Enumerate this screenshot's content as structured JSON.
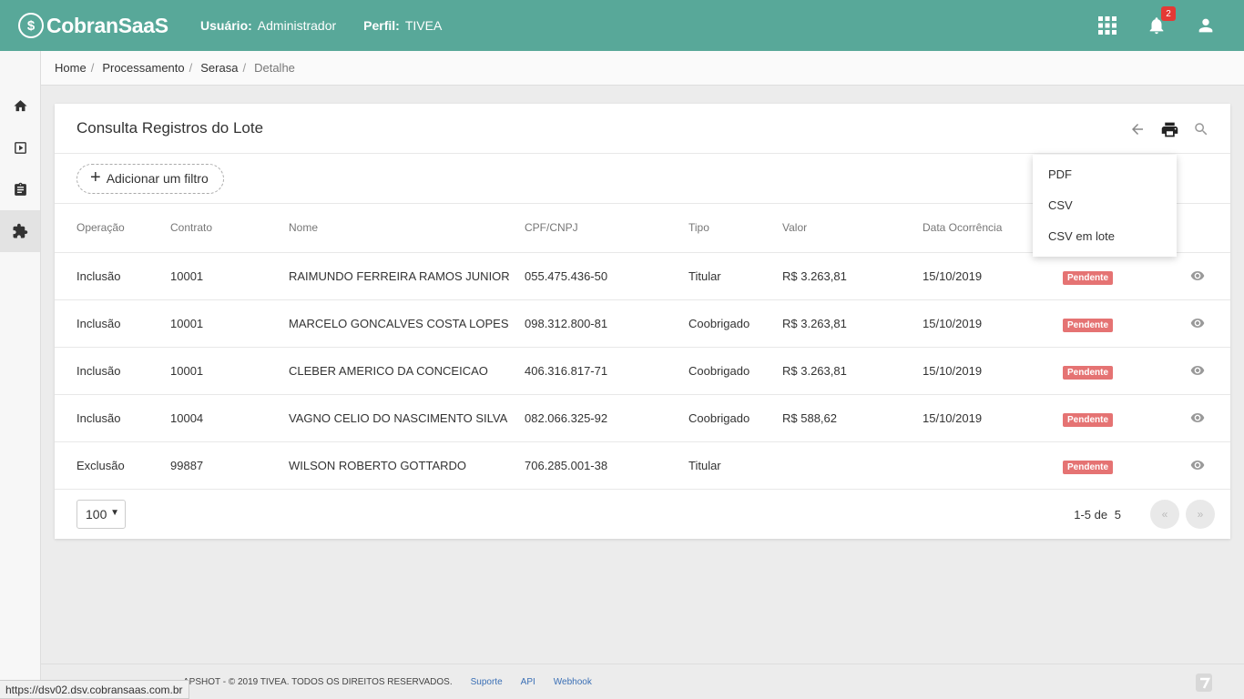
{
  "header": {
    "logo_text": "CobranSaaS",
    "user_label": "Usuário:",
    "user_value": "Administrador",
    "profile_label": "Perfil:",
    "profile_value": "TIVEA",
    "notification_count": "2"
  },
  "breadcrumb": {
    "items": [
      "Home",
      "Processamento",
      "Serasa",
      "Detalhe"
    ]
  },
  "card": {
    "title": "Consulta Registros do Lote",
    "filter_button": "Adicionar um filtro"
  },
  "table": {
    "headers": [
      "Operação",
      "Contrato",
      "Nome",
      "CPF/CNPJ",
      "Tipo",
      "Valor",
      "Data Ocorrência"
    ],
    "rows": [
      {
        "op": "Inclusão",
        "contrato": "10001",
        "nome": "RAIMUNDO FERREIRA RAMOS JUNIOR",
        "cpf": "055.475.436-50",
        "tipo": "Titular",
        "valor": "R$ 3.263,81",
        "data": "15/10/2019",
        "status": "Pendente"
      },
      {
        "op": "Inclusão",
        "contrato": "10001",
        "nome": "MARCELO GONCALVES COSTA LOPES",
        "cpf": "098.312.800-81",
        "tipo": "Coobrigado",
        "valor": "R$ 3.263,81",
        "data": "15/10/2019",
        "status": "Pendente"
      },
      {
        "op": "Inclusão",
        "contrato": "10001",
        "nome": "CLEBER AMERICO DA CONCEICAO",
        "cpf": "406.316.817-71",
        "tipo": "Coobrigado",
        "valor": "R$ 3.263,81",
        "data": "15/10/2019",
        "status": "Pendente"
      },
      {
        "op": "Inclusão",
        "contrato": "10004",
        "nome": "VAGNO CELIO DO NASCIMENTO SILVA",
        "cpf": "082.066.325-92",
        "tipo": "Coobrigado",
        "valor": "R$ 588,62",
        "data": "15/10/2019",
        "status": "Pendente"
      },
      {
        "op": "Exclusão",
        "contrato": "99887",
        "nome": "WILSON ROBERTO GOTTARDO",
        "cpf": "706.285.001-38",
        "tipo": "Titular",
        "valor": "",
        "data": "",
        "status": "Pendente"
      }
    ]
  },
  "pagination": {
    "page_size": "100",
    "range": "1-5",
    "of_label": "de",
    "total": "5",
    "prev": "«",
    "next": "»"
  },
  "print_menu": {
    "items": [
      "PDF",
      "CSV",
      "CSV em lote"
    ]
  },
  "footer": {
    "copyright": "APSHOT - © 2019 TIVEA. TODOS OS DIREITOS RESERVADOS.",
    "links": [
      "Suporte",
      "API",
      "Webhook"
    ],
    "status_url": "https://dsv02.dsv.cobransaas.com.br"
  },
  "colors": {
    "header_bg": "#58a899",
    "status_pending": "#e57373",
    "link": "#3a6fb5",
    "badge": "#e53935"
  }
}
